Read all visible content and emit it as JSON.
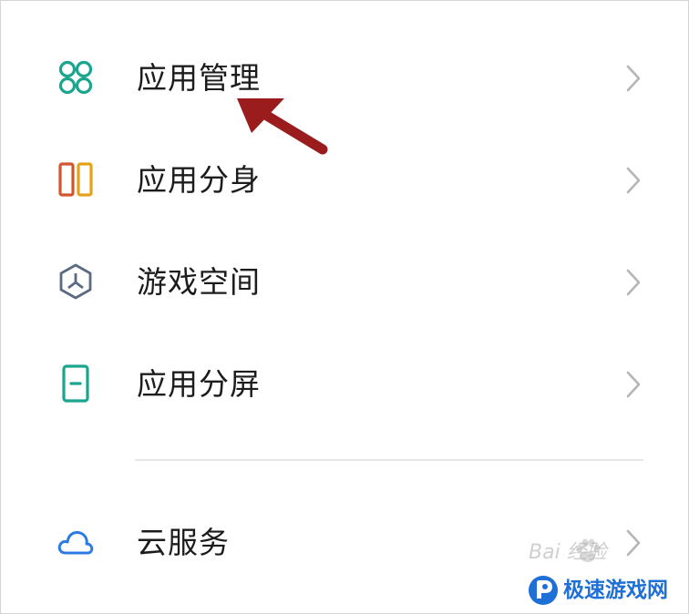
{
  "colors": {
    "text": "#1c1c1c",
    "chevron": "#b5b5b5",
    "icon_teal": "#1aa58e",
    "icon_orange_red": "#d2552d",
    "icon_yellow": "#e3a21a",
    "icon_game": "#5a6a84",
    "icon_cloud": "#2c7be5",
    "arrow": "#9b1c1c",
    "logo_blue": "#1e6fd6"
  },
  "settings": {
    "items": [
      {
        "label": "应用管理",
        "icon": "app-grid-icon"
      },
      {
        "label": "应用分身",
        "icon": "app-clone-icon"
      },
      {
        "label": "游戏空间",
        "icon": "game-space-icon"
      },
      {
        "label": "应用分屏",
        "icon": "split-screen-icon"
      },
      {
        "label": "云服务",
        "icon": "cloud-icon"
      }
    ]
  },
  "watermark": {
    "baidu_text": "Bai  经验",
    "site_name": "极速游戏网"
  }
}
